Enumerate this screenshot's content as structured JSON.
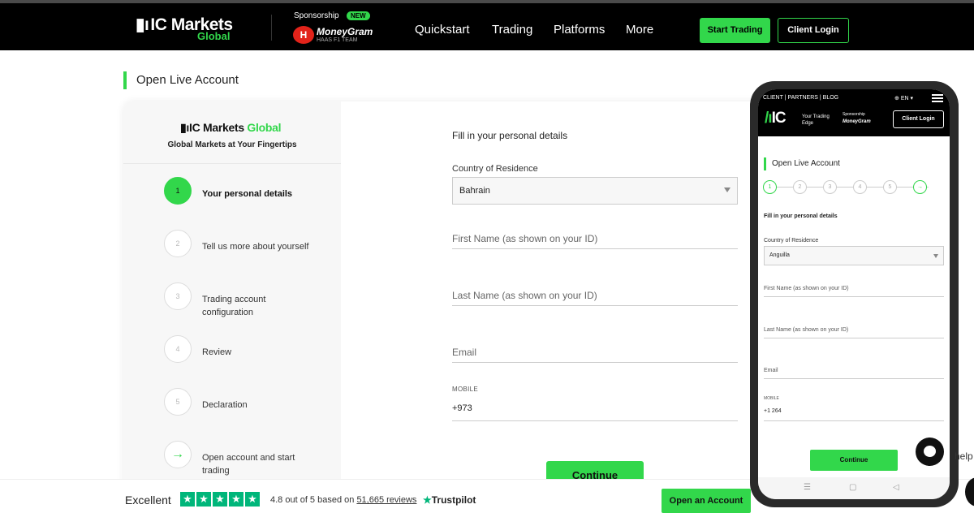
{
  "nav": {
    "logo": "IC Markets",
    "logo_sub": "Global",
    "sponsorship": "Sponsorship",
    "new_badge": "NEW",
    "moneygram": "MoneyGram",
    "haas": "HAAS F1 TEAM",
    "links": [
      "Quickstart",
      "Trading",
      "Platforms",
      "More"
    ],
    "start_trading": "Start Trading",
    "client_login": "Client Login"
  },
  "page": {
    "title": "Open Live Account"
  },
  "card": {
    "logo_dark": "IC Markets",
    "logo_green": "Global",
    "tagline": "Global Markets at Your Fingertips",
    "steps": [
      {
        "num": "1",
        "label": "Your personal details"
      },
      {
        "num": "2",
        "label": "Tell us more about yourself"
      },
      {
        "num": "3",
        "label": "Trading account configuration"
      },
      {
        "num": "4",
        "label": "Review"
      },
      {
        "num": "5",
        "label": "Declaration"
      },
      {
        "num": "→",
        "label": "Open account and start trading"
      }
    ]
  },
  "form": {
    "heading": "Fill in your personal details",
    "country_label": "Country of Residence",
    "country_value": "Bahrain",
    "first_name": "First Name (as shown on your ID)",
    "last_name": "Last Name (as shown on your ID)",
    "email": "Email",
    "mobile_label": "MOBILE",
    "mobile_value": "+973",
    "continue": "Continue"
  },
  "footer": {
    "excellent": "Excellent",
    "rating": "4.8 out of 5 based on",
    "reviews": "51,665 reviews",
    "trustpilot": "Trustpilot",
    "open_account": "Open an Account"
  },
  "phone": {
    "topline": "CLIENT | PARTNERS | BLOG",
    "lang": "EN",
    "logo": "IC",
    "edge": "Your Trading Edge",
    "sponsorship": "Sponsorship",
    "moneygram": "MoneyGram",
    "client_login": "Client Login",
    "title": "Open Live Account",
    "steps": [
      "1",
      "2",
      "3",
      "4",
      "5",
      "→"
    ],
    "heading": "Fill in your personal details",
    "country_label": "Country of Residence",
    "country_value": "Anguilla",
    "first_name": "First Name (as shown on your ID)",
    "last_name": "Last Name (as shown on your ID)",
    "email": "Email",
    "mobile_label": "MOBILE",
    "mobile_value": "+1 264",
    "continue": "Continue",
    "nav_icons": [
      "☰",
      "▢",
      "◁"
    ]
  },
  "help": "help"
}
